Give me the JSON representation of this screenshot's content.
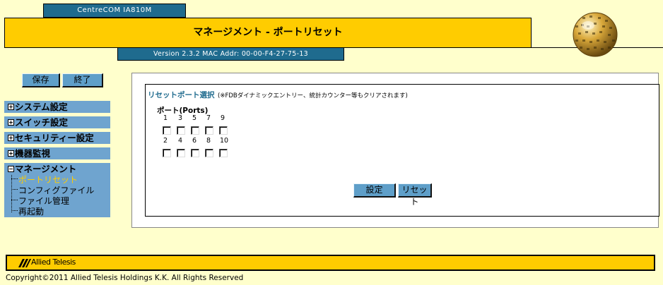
{
  "header": {
    "model": "CentreCOM IA810M",
    "title": "マネージメント - ポートリセット",
    "version_info": "Version 2.3.2 MAC Addr: 00-00-F4-27-75-13"
  },
  "sidebar": {
    "save_label": "保存",
    "end_label": "終了",
    "menu": [
      {
        "label": "システム設定"
      },
      {
        "label": "スイッチ設定"
      },
      {
        "label": "セキュリティー設定"
      },
      {
        "label": "機器監視"
      }
    ],
    "management": {
      "label": "マネージメント",
      "items": [
        {
          "label": "ポートリセット",
          "active": true
        },
        {
          "label": "コンフィグファイル"
        },
        {
          "label": "ファイル管理"
        },
        {
          "label": "再起動"
        }
      ]
    }
  },
  "main": {
    "section_title": "リセットポート選択",
    "section_note": "(※FDBダイナミックエントリー、統計カウンター等もクリアされます)",
    "ports_label": "ポート(Ports)",
    "ports_odd": [
      "1",
      "3",
      "5",
      "7",
      "9"
    ],
    "ports_even": [
      "2",
      "4",
      "6",
      "8",
      "10"
    ],
    "set_label": "設定",
    "reset_label": "リセット"
  },
  "footer": {
    "logo_text": "Allied Telesis",
    "copyright": "Copyright©2011 Allied Telesis Holdings K.K. All Rights Reserved"
  },
  "colors": {
    "accent_yellow": "#FFCC00",
    "header_blue": "#1F6B8E",
    "menu_blue": "#6FA4CF",
    "background": "#FFFFCC"
  }
}
